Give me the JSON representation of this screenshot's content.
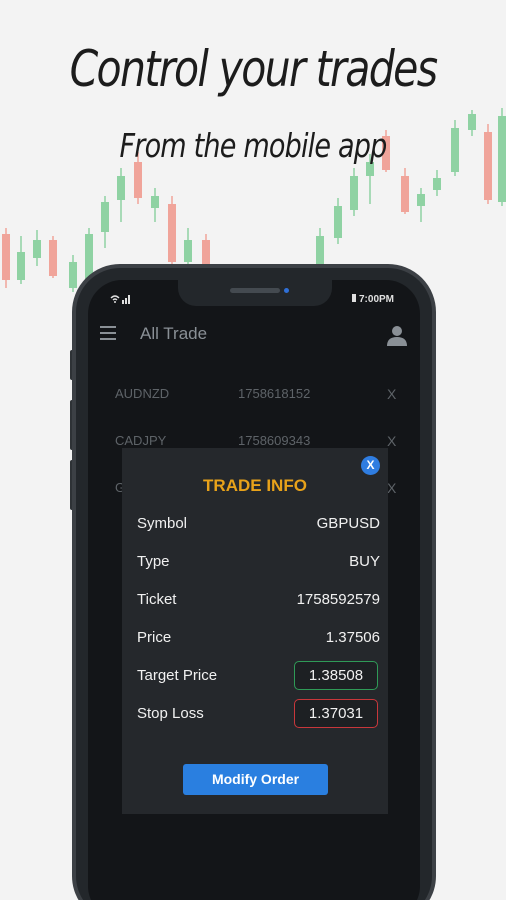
{
  "headline": "Control your trades",
  "subline": "From the mobile app",
  "status_bar": {
    "signal_icons": "wifi-signal",
    "time": "7:00PM"
  },
  "app_bar": {
    "title": "All Trade",
    "menu_icon": "hamburger-icon",
    "user_icon": "user-icon"
  },
  "trades": [
    {
      "symbol": "AUDNZD",
      "ticket": "1758618152",
      "close": "X"
    },
    {
      "symbol": "CADJPY",
      "ticket": "1758609343",
      "close": "X"
    },
    {
      "symbol": "G",
      "ticket": "",
      "close": "X"
    }
  ],
  "modal": {
    "close": "X",
    "title": "TRADE INFO",
    "symbol_label": "Symbol",
    "symbol_value": "GBPUSD",
    "type_label": "Type",
    "type_value": "BUY",
    "ticket_label": "Ticket",
    "ticket_value": "1758592579",
    "price_label": "Price",
    "price_value": "1.37506",
    "target_label": "Target Price",
    "target_value": "1.38508",
    "stop_label": "Stop Loss",
    "stop_value": "1.37031",
    "button": "Modify Order"
  },
  "colors": {
    "accent": "#e8a21a",
    "button": "#2a7fe0",
    "bull": "#8fd2a3",
    "bear": "#f0a49a"
  }
}
